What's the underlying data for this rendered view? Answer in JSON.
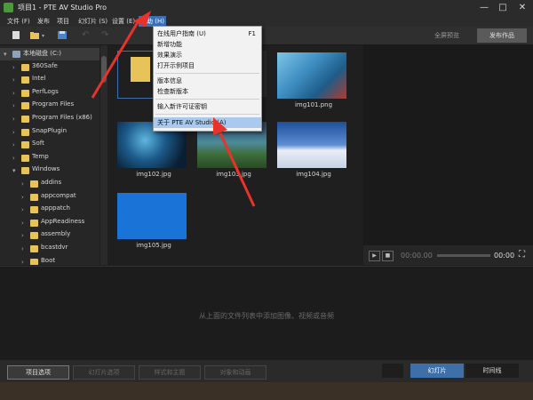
{
  "window": {
    "title": "项目1 - PTE AV Studio Pro",
    "controls": [
      "—",
      "□",
      "✕"
    ]
  },
  "menubar": {
    "items": [
      "文件 (F)",
      "发布",
      "项目",
      "幻灯片 (S)",
      "设置 (E)",
      "帮助 (H)"
    ]
  },
  "toolbar": {
    "preview_label": "全屏预览",
    "publish_label": "发布作品",
    "icons": [
      "new-icon",
      "open-icon",
      "save-icon",
      "undo-icon",
      "redo-icon"
    ]
  },
  "help_menu": {
    "items": [
      {
        "label": "在线用户指南 (U)",
        "shortcut": "F1"
      },
      {
        "label": "新增功能",
        "shortcut": ""
      },
      {
        "label": "效果演示",
        "shortcut": ""
      },
      {
        "label": "打开示例项目",
        "shortcut": ""
      },
      {
        "label": "版本信息",
        "shortcut": ""
      },
      {
        "label": "检查新版本",
        "shortcut": ""
      },
      {
        "label": "输入新许可证密钥",
        "shortcut": ""
      },
      {
        "label": "关于 PTE AV Studio (A)",
        "shortcut": ""
      }
    ]
  },
  "tree": {
    "items": [
      {
        "label": "本地磁盘 (C:)",
        "expanded": true,
        "indent": 0
      },
      {
        "label": "360Safe",
        "expanded": false,
        "indent": 1
      },
      {
        "label": "Intel",
        "expanded": false,
        "indent": 1
      },
      {
        "label": "PerfLogs",
        "expanded": false,
        "indent": 1
      },
      {
        "label": "Program Files",
        "expanded": false,
        "indent": 1
      },
      {
        "label": "Program Files (x86)",
        "expanded": false,
        "indent": 1
      },
      {
        "label": "SnapPlugin",
        "expanded": false,
        "indent": 1
      },
      {
        "label": "Soft",
        "expanded": false,
        "indent": 1
      },
      {
        "label": "Temp",
        "expanded": false,
        "indent": 1
      },
      {
        "label": "Windows",
        "expanded": true,
        "indent": 1
      },
      {
        "label": "addins",
        "expanded": false,
        "indent": 2
      },
      {
        "label": "appcompat",
        "expanded": false,
        "indent": 2
      },
      {
        "label": "apppatch",
        "expanded": false,
        "indent": 2
      },
      {
        "label": "AppReadiness",
        "expanded": false,
        "indent": 2
      },
      {
        "label": "assembly",
        "expanded": false,
        "indent": 2
      },
      {
        "label": "bcastdvr",
        "expanded": false,
        "indent": 2
      },
      {
        "label": "Boot",
        "expanded": false,
        "indent": 2
      }
    ]
  },
  "files": {
    "items": [
      {
        "label": "",
        "kind": "folder"
      },
      {
        "label": "",
        "kind": "image-hidden"
      },
      {
        "label": "img101.png",
        "kind": "image"
      },
      {
        "label": "img102.jpg",
        "kind": "image"
      },
      {
        "label": "img103.jpg",
        "kind": "image"
      },
      {
        "label": "img104.jpg",
        "kind": "image"
      },
      {
        "label": "img105.jpg",
        "kind": "image"
      }
    ]
  },
  "player": {
    "time_current": "00:00.00",
    "time_total": "00:00",
    "play_icon": "play-icon",
    "stop_icon": "stop-icon",
    "fullscreen_icon": "fullscreen-icon"
  },
  "slides": {
    "empty_hint": "从上面的文件列表中添加图像、视频或音频"
  },
  "bottom": {
    "buttons": [
      "项目选项",
      "幻灯片选项",
      "样式和主题",
      "对象和动画"
    ],
    "tabs": [
      "幻灯片",
      "时间线"
    ]
  },
  "colors": {
    "accent": "#3d6fb4",
    "menu_highlight": "#a9c9ee",
    "folder": "#e8c35a",
    "annotation": "#e8322a"
  }
}
